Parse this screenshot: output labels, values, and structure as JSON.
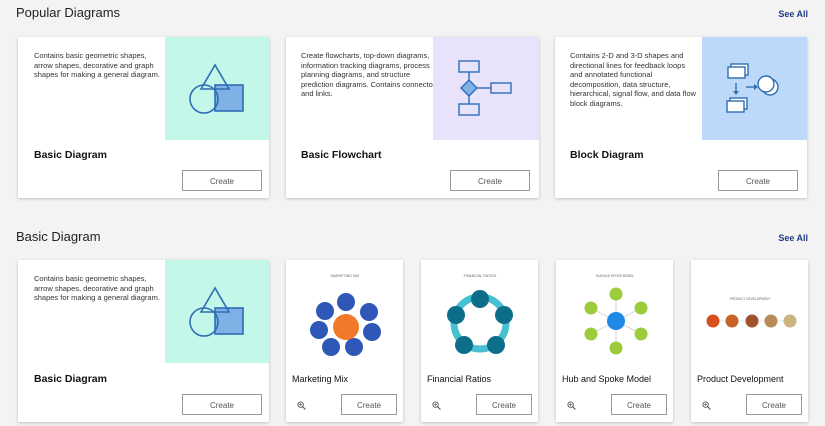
{
  "popular": {
    "title": "Popular Diagrams",
    "see_all": "See All",
    "cards": [
      {
        "name": "Basic Diagram",
        "desc": "Contains basic geometric shapes, arrow shapes, decorative and graph shapes for making a general diagram.",
        "button": "Create",
        "preview_color": "#c2f7ea",
        "icon": "basic-shapes-icon"
      },
      {
        "name": "Basic Flowchart",
        "desc": "Create flowcharts, top-down diagrams, information tracking diagrams, process planning diagrams, and structure prediction diagrams. Contains connectors and links.",
        "button": "Create",
        "preview_color": "#e9e2fb",
        "icon": "flowchart-icon"
      },
      {
        "name": "Block Diagram",
        "desc": "Contains 2-D and 3-D shapes and directional lines for feedback loops and annotated functional decomposition, data structure, hierarchical, signal flow, and data flow block diagrams.",
        "button": "Create",
        "preview_color": "#bcd9f9",
        "icon": "block-diagram-icon"
      }
    ]
  },
  "basic": {
    "title": "Basic Diagram",
    "see_all": "See All",
    "main_card": {
      "name": "Basic Diagram",
      "desc": "Contains basic geometric shapes, arrow shapes, decorative and graph shapes for making a general diagram.",
      "button": "Create"
    },
    "templates": [
      {
        "name": "Marketing Mix",
        "thumb_title": "MARKETING MIX",
        "button": "Create"
      },
      {
        "name": "Financial Ratios",
        "thumb_title": "FINANCIAL RATIOS",
        "button": "Create"
      },
      {
        "name": "Hub and Spoke Model",
        "thumb_title": "HUB AND SPOKE MODEL",
        "button": "Create"
      },
      {
        "name": "Product Development",
        "thumb_title": "PRODUCT DEVELOPMENT",
        "button": "Create"
      }
    ]
  },
  "colors": {
    "accent_blue": "#1f3c88",
    "icon_blue": "#2f6db5",
    "shape_fill": "#7fb0e6"
  }
}
